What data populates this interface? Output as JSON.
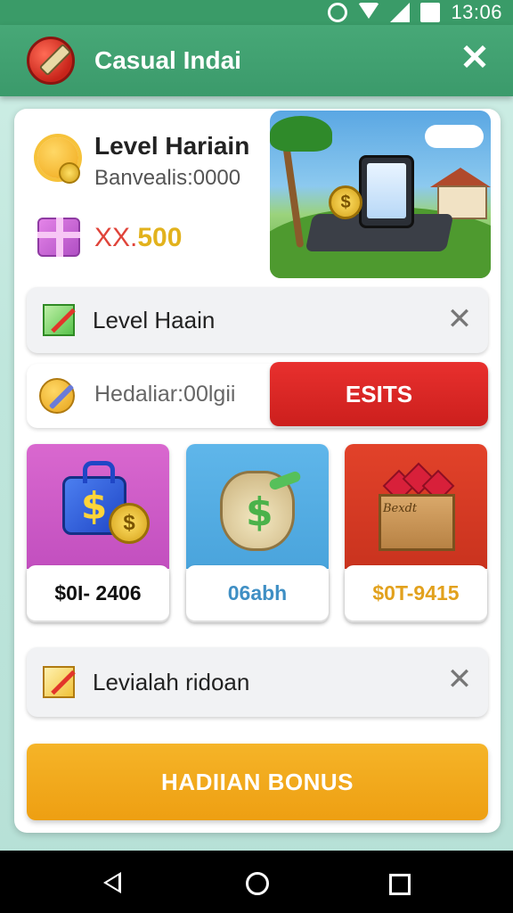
{
  "status_bar": {
    "time": "13:06"
  },
  "header": {
    "title": "Casual Indai"
  },
  "level_card": {
    "title": "Level Hariain",
    "subtitle": "Banvealis:0000",
    "amount_prefix": "XX.",
    "amount_value": "500"
  },
  "row1": {
    "label": "Level Haain"
  },
  "row2": {
    "label": "Hedaliar:00lgii",
    "button_label": "ESITS"
  },
  "tiles": [
    {
      "label": "$0I- 2406",
      "label_color": "#111111"
    },
    {
      "label": "06abh",
      "label_color": "#3f8fc4"
    },
    {
      "label": "$0T-9415",
      "label_color": "#e2a11d",
      "box_text": "Bexdt"
    }
  ],
  "row3": {
    "label": "Levialah ridoan"
  },
  "bonus_button": {
    "label": "HADIIAN BONUS"
  },
  "colors": {
    "header_green": "#3b9a6b",
    "exit_red": "#cc1f1d",
    "bonus_orange": "#f0a518",
    "amount_gold": "#e2b21d"
  }
}
